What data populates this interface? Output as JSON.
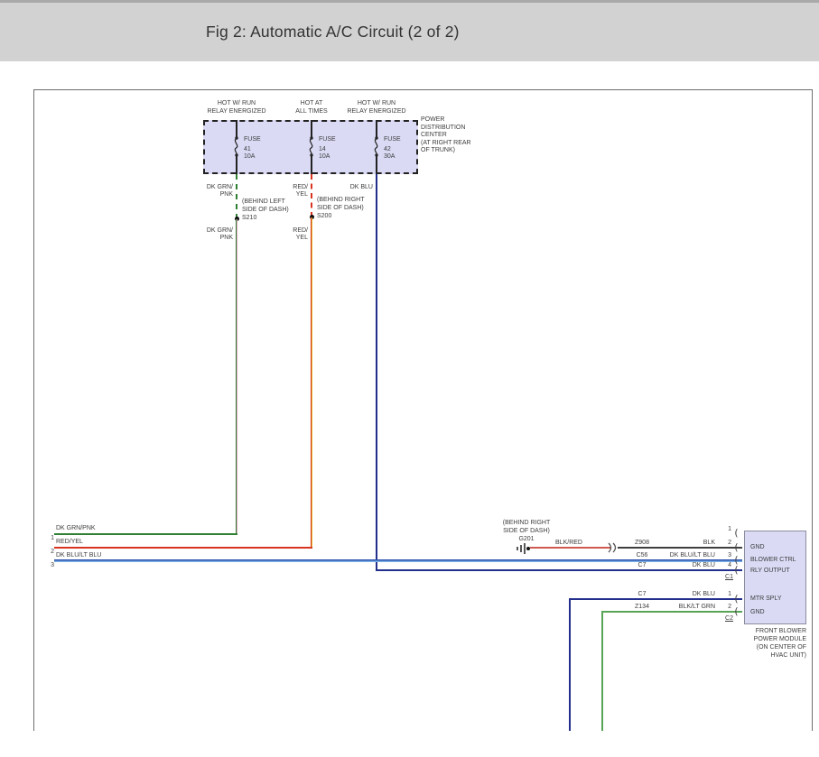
{
  "title": "Fig 2: Automatic A/C Circuit (2 of 2)",
  "colors": {
    "header-bg": "#d2d2d2",
    "box-fill": "#dadaf5",
    "ink": "#3d3d3d",
    "frame": "#6e6e6e",
    "wire-black": "#3f3f3f",
    "green": "#2f8032",
    "pink": "#e2a4bc",
    "red": "#d93420",
    "yellow": "#e2bd2c",
    "dkblu": "#232f8c",
    "midblu": "#2b4fae",
    "ltblu": "#7ab2e4",
    "blkred": "#cd5950",
    "ltgrn": "#57a457"
  },
  "power_center": {
    "headers": [
      [
        "HOT W/ RUN",
        "RELAY ENERGIZED"
      ],
      [
        "HOT AT",
        "ALL TIMES"
      ],
      [
        "HOT W/ RUN",
        "RELAY ENERGIZED"
      ]
    ],
    "fuses": [
      {
        "word": "FUSE",
        "num": "41",
        "amps": "10A"
      },
      {
        "word": "FUSE",
        "num": "14",
        "amps": "10A"
      },
      {
        "word": "FUSE",
        "num": "42",
        "amps": "30A"
      }
    ],
    "label": [
      "POWER",
      "DISTRIBUTION",
      "CENTER",
      "(AT RIGHT REAR",
      "OF TRUNK)"
    ]
  },
  "splices": {
    "left": {
      "c1": "DK GRN/",
      "c2": "PNK",
      "l1": "(BEHIND LEFT",
      "l2": "SIDE OF DASH)",
      "id": "S210",
      "b1": "DK GRN/",
      "b2": "PNK"
    },
    "right": {
      "c1": "RED/",
      "c2": "YEL",
      "l1": "(BEHIND RIGHT",
      "l2": "SIDE OF DASH)",
      "id": "S200",
      "b1": "RED/",
      "b2": "YEL"
    },
    "blu": "DK BLU"
  },
  "rows": [
    {
      "num": "1",
      "label": "DK GRN/PNK"
    },
    {
      "num": "2",
      "label": "RED/YEL"
    },
    {
      "num": "3",
      "label": "DK BLU/LT BLU"
    }
  ],
  "ground": {
    "l1": "(BEHIND RIGHT",
    "l2": "SIDE OF DASH)",
    "id": "G201",
    "wire": "BLK/RED"
  },
  "conn": {
    "c1_pins": [
      {
        "num": "1",
        "circuit": "",
        "color": "",
        "label": ""
      },
      {
        "num": "2",
        "circuit": "Z908",
        "color": "BLK",
        "label": "GND"
      },
      {
        "num": "3",
        "circuit": "C56",
        "color": "DK BLU/LT BLU",
        "label": "BLOWER CTRL"
      },
      {
        "num": "4",
        "circuit": "C7",
        "color": "DK BLU",
        "label": "RLY OUTPUT"
      }
    ],
    "c1": "C1",
    "c2_pins": [
      {
        "num": "1",
        "circuit": "C7",
        "color": "DK BLU",
        "label": "MTR SPLY"
      },
      {
        "num": "2",
        "circuit": "Z134",
        "color": "BLK/LT GRN",
        "label": "GND"
      }
    ],
    "c2": "C2",
    "module": [
      "FRONT BLOWER",
      "POWER MODULE",
      "(ON CENTER OF",
      "HVAC UNIT)"
    ]
  }
}
